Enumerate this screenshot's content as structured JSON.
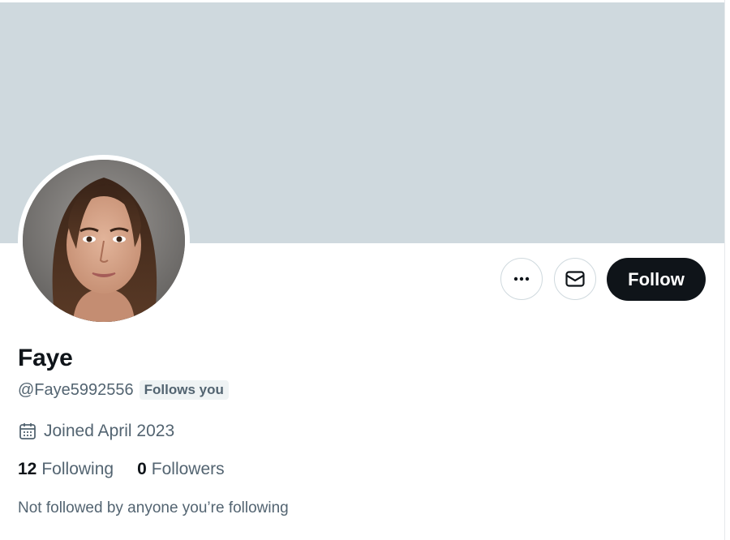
{
  "profile": {
    "name": "Faye",
    "handle": "@Faye5992556",
    "follows_you_badge": "Follows you",
    "joined": "Joined April 2023",
    "following_count": "12",
    "following_label": "Following",
    "followers_count": "0",
    "followers_label": "Followers",
    "mutual_note": "Not followed by anyone you’re following"
  },
  "actions": {
    "more_icon": "more-horizontal-icon",
    "message_icon": "envelope-icon",
    "follow_label": "Follow"
  },
  "colors": {
    "banner": "#cfd9de",
    "primary_text": "#0f1419",
    "secondary_text": "#536471",
    "follow_button_bg": "#0f1419"
  }
}
